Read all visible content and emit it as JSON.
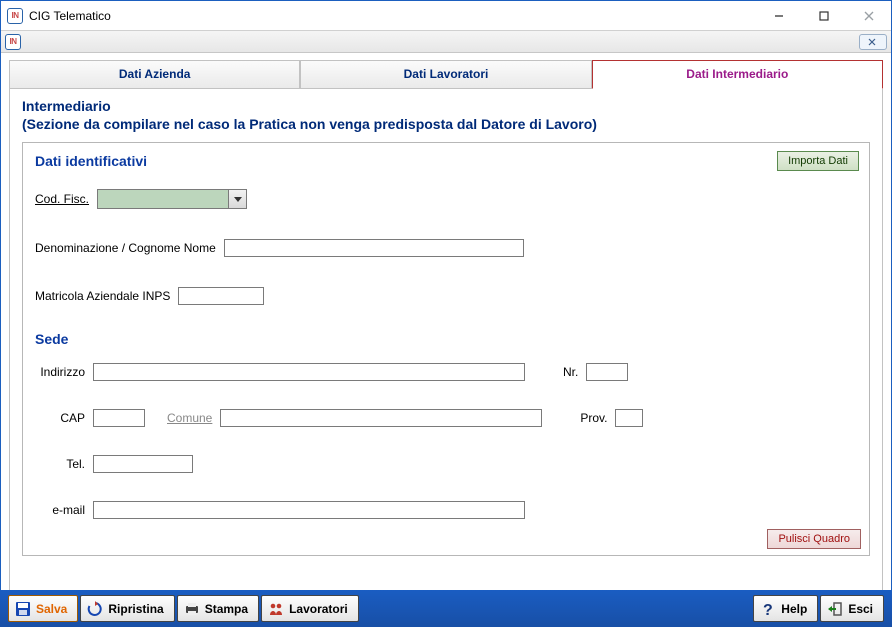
{
  "window": {
    "title": "CIG Telematico"
  },
  "tabs": {
    "azienda": "Dati Azienda",
    "lavoratori": "Dati Lavoratori",
    "intermediario": "Dati Intermediario"
  },
  "header": {
    "title": "Intermediario",
    "subtitle": "(Sezione da compilare nel caso la Pratica non venga predisposta dal Datore di Lavoro)"
  },
  "section": {
    "legend": "Dati identificativi",
    "importa": "Importa Dati",
    "cod_fisc_label": "Cod. Fisc.",
    "cod_fisc_value": "",
    "denominazione_label": "Denominazione / Cognome Nome",
    "denominazione_value": "",
    "matricola_label": "Matricola Aziendale INPS",
    "matricola_value": "",
    "sede_title": "Sede",
    "indirizzo_label": "Indirizzo",
    "indirizzo_value": "",
    "nr_label": "Nr.",
    "nr_value": "",
    "cap_label": "CAP",
    "cap_value": "",
    "comune_label": "Comune",
    "comune_value": "",
    "prov_label": "Prov.",
    "prov_value": "",
    "tel_label": "Tel.",
    "tel_value": "",
    "email_label": "e-mail",
    "email_value": "",
    "pulisci": "Pulisci Quadro"
  },
  "toolbar": {
    "salva": "Salva",
    "ripristina": "Ripristina",
    "stampa": "Stampa",
    "lavoratori": "Lavoratori",
    "help": "Help",
    "esci": "Esci"
  }
}
